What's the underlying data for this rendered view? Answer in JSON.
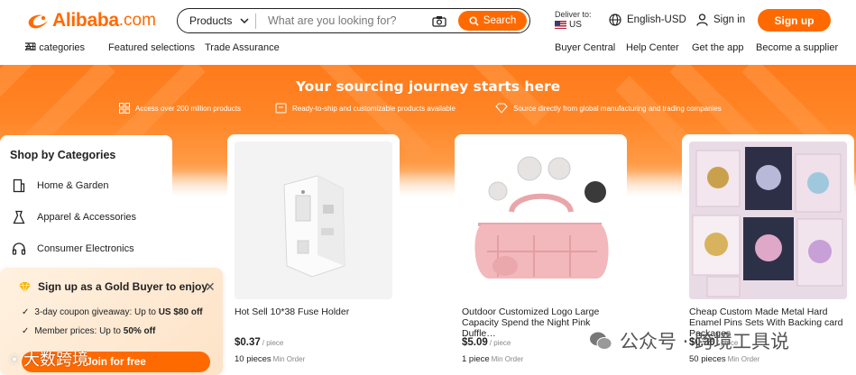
{
  "header": {
    "logo_brand": "Alibaba",
    "logo_tld": ".com",
    "search_category": "Products",
    "search_placeholder": "What are you looking for?",
    "search_button": "Search",
    "deliver_label": "Deliver to:",
    "deliver_country": "US",
    "language_currency": "English-USD",
    "sign_in": "Sign in",
    "sign_up": "Sign up"
  },
  "nav": {
    "all_categories": "All categories",
    "featured": "Featured selections",
    "trade_assurance": "Trade Assurance",
    "buyer_central": "Buyer Central",
    "help_center": "Help Center",
    "get_app": "Get the app",
    "become_supplier": "Become a supplier"
  },
  "banner": {
    "title": "Your sourcing journey starts here",
    "features": [
      "Access over 200 million products",
      "Ready-to-ship and customizable products available",
      "Source directly from global manufacturing and trading companies"
    ]
  },
  "categories": {
    "title": "Shop by Categories",
    "items": [
      "Home & Garden",
      "Apparel & Accessories",
      "Consumer Electronics"
    ]
  },
  "gold_popup": {
    "title": "Sign up as a Gold Buyer to enjoy",
    "line1_text": "3-day coupon giveaway: Up to ",
    "line1_bold": "US $80 off",
    "line2_text": "Member prices: Up to ",
    "line2_bold": "50% off",
    "cta": "Join for free"
  },
  "products": [
    {
      "title": "Hot Sell 10*38 Fuse Holder",
      "price": "$0.37",
      "price_unit": "/ piece",
      "min_qty": "10 pieces",
      "min_label": "Min Order"
    },
    {
      "title": "Outdoor Customized Logo Large Capacity Spend the Night Pink Duffle…",
      "price": "$5.09",
      "price_unit": "/ piece",
      "min_qty": "1 piece",
      "min_label": "Min Order"
    },
    {
      "title": "Cheap Custom Made Metal Hard Enamel Pins Sets With Backing card Packages",
      "price": "$0.30",
      "price_unit": "/ piece",
      "min_qty": "50 pieces",
      "min_label": "Min Order"
    }
  ],
  "watermarks": {
    "left": "大数跨境",
    "right": "公众号 · 跨境工具说"
  },
  "colors": {
    "accent": "#ff6a00"
  }
}
